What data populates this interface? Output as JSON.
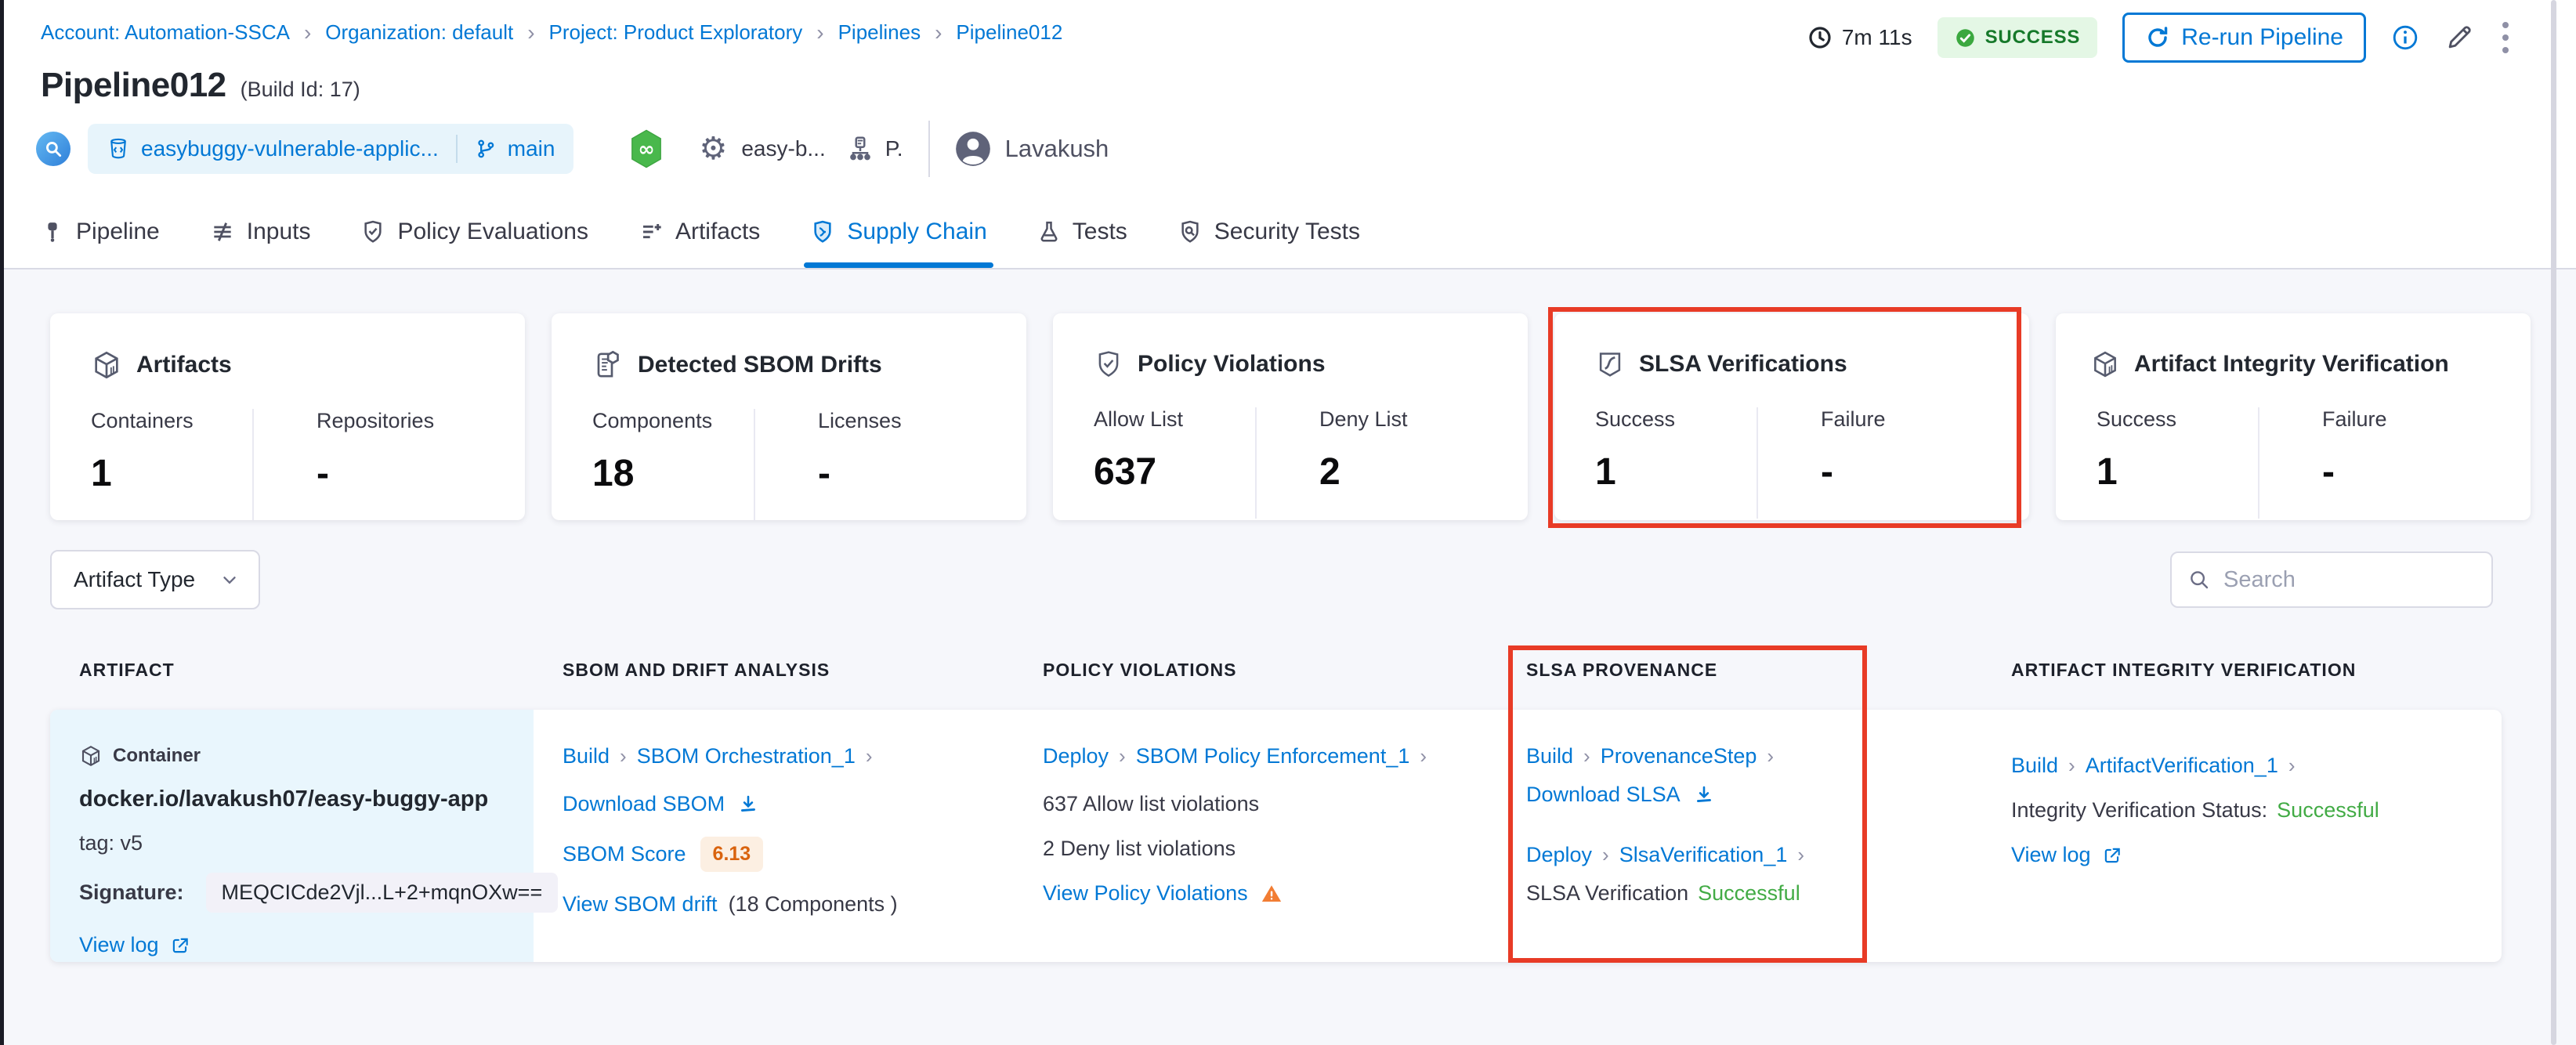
{
  "colors": {
    "accent": "#0278d5",
    "success_text": "#42ab45",
    "success_badge_bg": "#e4f7e5",
    "success_badge_text": "#16792a",
    "warning_orange": "#ff7b26",
    "score_orange": "#d9630e",
    "annotation_red": "#e83b26",
    "artifact_cell_bg": "#e9f6fd"
  },
  "breadcrumb": [
    "Account: Automation-SSCA",
    "Organization: default",
    "Project: Product Exploratory",
    "Pipelines",
    "Pipeline012"
  ],
  "header": {
    "title": "Pipeline012",
    "build_id": "(Build Id: 17)",
    "duration": "7m 11s",
    "status": "SUCCESS",
    "rerun": "Re-run Pipeline",
    "repo": "easybuggy-vulnerable-applic...",
    "branch": "main",
    "trigger": "easy-b...",
    "stage_short": "P.",
    "user": "Lavakush"
  },
  "tabs": [
    {
      "label": "Pipeline"
    },
    {
      "label": "Inputs"
    },
    {
      "label": "Policy Evaluations"
    },
    {
      "label": "Artifacts"
    },
    {
      "label": "Supply Chain"
    },
    {
      "label": "Tests"
    },
    {
      "label": "Security Tests"
    }
  ],
  "active_tab": "Supply Chain",
  "cards": [
    {
      "title": "Artifacts",
      "metrics": [
        {
          "label": "Containers",
          "value": "1"
        },
        {
          "label": "Repositories",
          "value": "-"
        }
      ]
    },
    {
      "title": "Detected SBOM Drifts",
      "metrics": [
        {
          "label": "Components",
          "value": "18"
        },
        {
          "label": "Licenses",
          "value": "-"
        }
      ]
    },
    {
      "title": "Policy Violations",
      "metrics": [
        {
          "label": "Allow List",
          "value": "637"
        },
        {
          "label": "Deny List",
          "value": "2"
        }
      ]
    },
    {
      "title": "SLSA Verifications",
      "highlighted": true,
      "metrics": [
        {
          "label": "Success",
          "value": "1"
        },
        {
          "label": "Failure",
          "value": "-"
        }
      ]
    },
    {
      "title": "Artifact Integrity Verification",
      "metrics": [
        {
          "label": "Success",
          "value": "1"
        },
        {
          "label": "Failure",
          "value": "-"
        }
      ]
    }
  ],
  "filters": {
    "artifact_type_label": "Artifact Type",
    "search_placeholder": "Search"
  },
  "table": {
    "columns": [
      "ARTIFACT",
      "SBOM AND DRIFT ANALYSIS",
      "POLICY VIOLATIONS",
      "SLSA PROVENANCE",
      "ARTIFACT INTEGRITY VERIFICATION"
    ],
    "row": {
      "artifact": {
        "type": "Container",
        "image": "docker.io/lavakush07/easy-buggy-app",
        "tag": "tag: v5",
        "signature_label": "Signature:",
        "signature_value": "MEQCICde2Vjl...L+2+mqnOXw==",
        "view_log": "View log"
      },
      "sbom": {
        "stage": "Build",
        "step": "SBOM Orchestration_1",
        "download": "Download SBOM",
        "score_label": "SBOM Score",
        "score_value": "6.13",
        "drift_link": "View SBOM drift",
        "drift_note": "(18 Components )"
      },
      "policy": {
        "stage": "Deploy",
        "step": "SBOM Policy Enforcement_1",
        "allow": "637 Allow list violations",
        "deny": "2 Deny list violations",
        "view": "View Policy Violations"
      },
      "slsa": {
        "stage1": "Build",
        "step1": "ProvenanceStep",
        "download": "Download SLSA",
        "stage2": "Deploy",
        "step2": "SlsaVerification_1",
        "status_label": "SLSA Verification",
        "status_value": "Successful"
      },
      "integrity": {
        "stage": "Build",
        "step": "ArtifactVerification_1",
        "status_label": "Integrity Verification Status:",
        "status_value": "Successful",
        "view_log": "View log"
      }
    }
  }
}
